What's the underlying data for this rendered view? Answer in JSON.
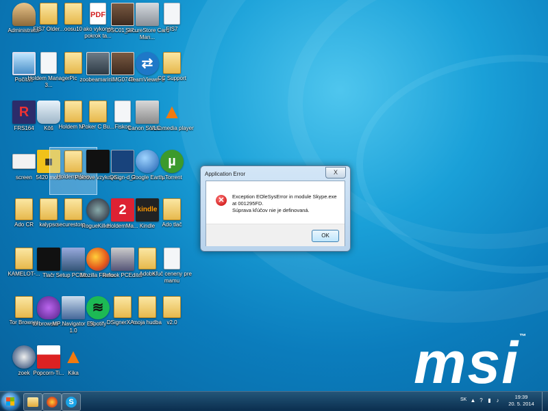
{
  "desktop": {
    "brand": "msi",
    "brand_mark": "™",
    "icons": [
      {
        "label": "Administrator",
        "icon": "user-icon"
      },
      {
        "label": "FIS7 Older...",
        "icon": "folder-icon"
      },
      {
        "label": "oosu10",
        "icon": "folder-icon"
      },
      {
        "label": "ako vykonat pokrok ta...",
        "icon": "pdf-icon"
      },
      {
        "label": "DSC01_37...",
        "icon": "photo-icon"
      },
      {
        "label": "SecureStore Card Man...",
        "icon": "keys-icon"
      },
      {
        "label": "FIS7",
        "icon": "file-icon"
      },
      {
        "label": "Počítač",
        "icon": "computer-icon"
      },
      {
        "label": "Holdem Manager 3...",
        "icon": "file-icon"
      },
      {
        "label": "Pic",
        "icon": "folder-icon"
      },
      {
        "label": "zoobeamarin...",
        "icon": "app-icon"
      },
      {
        "label": "IMG0748",
        "icon": "photo-icon"
      },
      {
        "label": "TeamViewer 8",
        "icon": "teamviewer-icon"
      },
      {
        "label": "CC Support",
        "icon": "folder-icon"
      },
      {
        "label": "FRS164",
        "icon": "fr-icon"
      },
      {
        "label": "Kôš",
        "icon": "recycle-bin-icon"
      },
      {
        "label": "Holdem M...",
        "icon": "folder-icon"
      },
      {
        "label": "Poker C Bu...",
        "icon": "folder-icon"
      },
      {
        "label": "Fiskog",
        "icon": "file-icon"
      },
      {
        "label": "Canon Solutio...",
        "icon": "canon-icon"
      },
      {
        "label": "VLC media player",
        "icon": "vlc-icon"
      },
      {
        "label": "screen",
        "icon": "envelope-icon"
      },
      {
        "label": "5420 modi",
        "icon": "sticky-icon"
      },
      {
        "label": "Holdem slovo",
        "icon": "folder-icon"
      },
      {
        "label": "Pokrove vzykove...",
        "icon": "poker-icon"
      },
      {
        "label": "QSign-d_2",
        "icon": "sign-icon"
      },
      {
        "label": "Google Earth",
        "icon": "google-earth-icon"
      },
      {
        "label": "µTorrent",
        "icon": "utorrent-icon"
      },
      {
        "label": "Ado CR",
        "icon": "folder-icon"
      },
      {
        "label": "kalypso",
        "icon": "folder-icon"
      },
      {
        "label": "securestoro...",
        "icon": "folder-icon"
      },
      {
        "label": "RogueKillet...",
        "icon": "roguekiller-icon"
      },
      {
        "label": "HoldemMa...",
        "icon": "holdem-icon"
      },
      {
        "label": "Kindle",
        "icon": "kindle-icon"
      },
      {
        "label": "Ado tlač",
        "icon": "folder-icon"
      },
      {
        "label": "KAMELOT-...",
        "icon": "folder-icon"
      },
      {
        "label": "Tlačr",
        "icon": "poker-icon"
      },
      {
        "label": "Setup PCEd...",
        "icon": "setup-icon"
      },
      {
        "label": "Mozilla Firefox",
        "icon": "firefox-icon"
      },
      {
        "label": "Relook PCEditor",
        "icon": "pceditor-icon"
      },
      {
        "label": "Adobe",
        "icon": "folder-icon"
      },
      {
        "label": "Kľuč ceneny pre mamu",
        "icon": "file-icon"
      },
      {
        "label": "Tor Browser",
        "icon": "folder-icon"
      },
      {
        "label": "torbrowser-...",
        "icon": "tor-icon"
      },
      {
        "label": "MP Navigator EX 1.0",
        "icon": "mp-navigator-icon"
      },
      {
        "label": "Spotify",
        "icon": "spotify-icon"
      },
      {
        "label": "DSignerXA...",
        "icon": "folder-icon"
      },
      {
        "label": "moja hudba",
        "icon": "folder-icon"
      },
      {
        "label": "v2.0",
        "icon": "folder-icon"
      },
      {
        "label": "zoek",
        "icon": "zoek-icon"
      },
      {
        "label": "Popcorn-Ti...",
        "icon": "popcorn-icon"
      },
      {
        "label": "Kika",
        "icon": "vlc-icon"
      }
    ]
  },
  "dialog": {
    "title": "Application Error",
    "close_label": "X",
    "message_line1": "Exception EOleSysError in module Skype.exe at 001295FD.",
    "message_line2": "Súprava kľúčov nie je definovaná.",
    "ok_label": "OK"
  },
  "taskbar": {
    "pinned": [
      "windows-explorer",
      "mozilla-firefox",
      "skype"
    ],
    "skype_glyph": "S",
    "language": "SK",
    "time": "19:39",
    "date": "20. 5. 2014"
  }
}
